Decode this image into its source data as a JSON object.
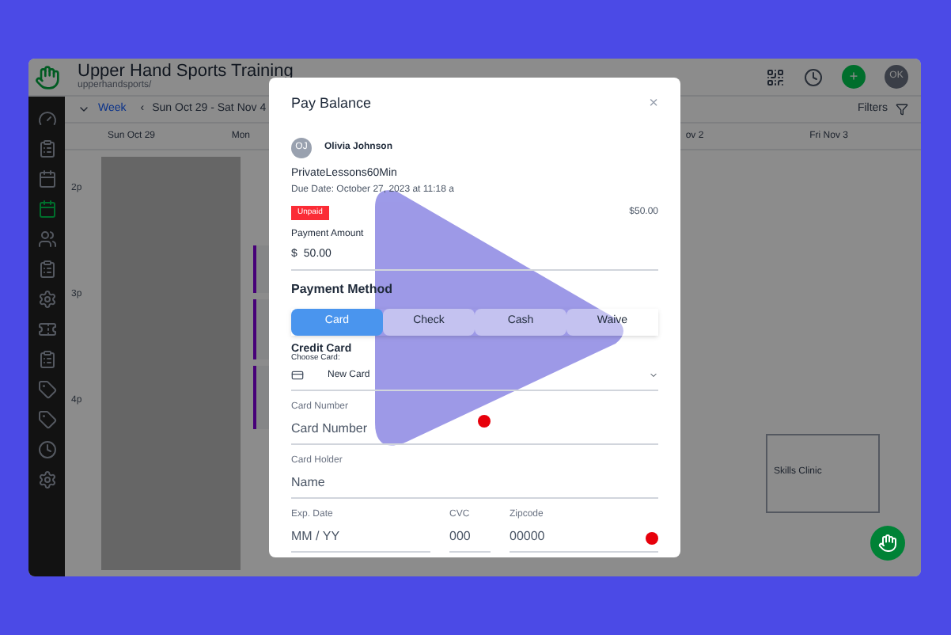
{
  "app": {
    "title": "Upper Hand Sports Training",
    "subtitle": "upperhandsports/",
    "add": "+",
    "avatar": "OK"
  },
  "toolbar": {
    "view": "Week",
    "prev": "‹",
    "range": "Sun Oct 29 - Sat Nov 4",
    "filters": "Filters"
  },
  "days": [
    {
      "label": "Sun Oct 29"
    },
    {
      "label": "Mon"
    },
    {
      "label": "ov 2"
    },
    {
      "label": "Fri Nov 3"
    }
  ],
  "times": [
    "2p",
    "3p",
    "4p"
  ],
  "event": {
    "title": "Skills Clinic"
  },
  "modal": {
    "title": "Pay Balance",
    "close": "×",
    "client": {
      "initials": "OJ",
      "name": "Olivia Johnson"
    },
    "item": "PrivateLessons60Min",
    "due": "Due Date: October 27, 2023 at 11:18 a",
    "status": "Unpaid",
    "total": "$50.00",
    "amount_label": "Payment Amount",
    "currency": "$",
    "amount": "50.00",
    "method_heading": "Payment Method",
    "methods": [
      {
        "label": "Card",
        "selected": true
      },
      {
        "label": "Check",
        "selected": false
      },
      {
        "label": "Cash",
        "selected": false
      },
      {
        "label": "Waive",
        "selected": false
      }
    ],
    "card_heading": "Credit Card",
    "choose_label": "Choose Card:",
    "card_choice": "New Card",
    "card_number": {
      "label": "Card Number",
      "placeholder": "Card Number"
    },
    "card_holder": {
      "label": "Card Holder",
      "placeholder": "Name"
    },
    "exp": {
      "label": "Exp. Date",
      "placeholder": "MM / YY"
    },
    "cvc": {
      "label": "CVC",
      "placeholder": "000"
    },
    "zip": {
      "label": "Zipcode",
      "placeholder": "00000"
    }
  }
}
